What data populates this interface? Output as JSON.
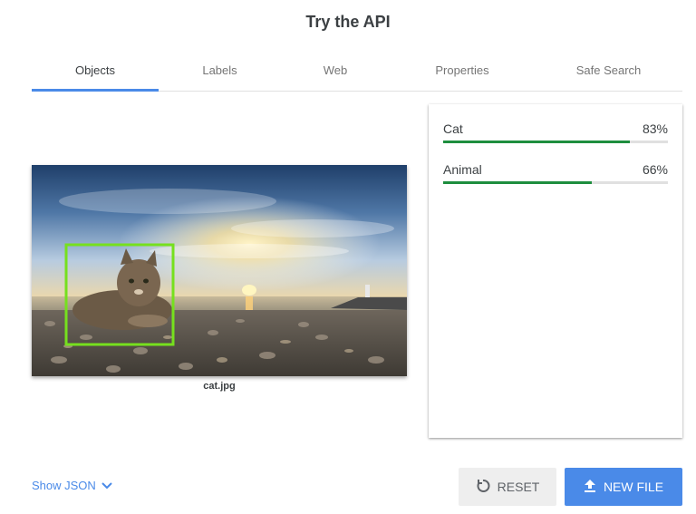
{
  "page": {
    "title": "Try the API"
  },
  "tabs": [
    {
      "label": "Objects",
      "active": true
    },
    {
      "label": "Labels",
      "active": false
    },
    {
      "label": "Web",
      "active": false
    },
    {
      "label": "Properties",
      "active": false
    },
    {
      "label": "Safe Search",
      "active": false
    }
  ],
  "image": {
    "caption": "cat.jpg",
    "detection_box_color": "#76e01e"
  },
  "results": [
    {
      "label": "Cat",
      "score_text": "83%",
      "score": 0.83
    },
    {
      "label": "Animal",
      "score_text": "66%",
      "score": 0.66
    }
  ],
  "footer": {
    "show_json_label": "Show JSON",
    "reset_label": "RESET",
    "new_file_label": "NEW FILE"
  },
  "colors": {
    "accent": "#4a8ae8",
    "bar_fill": "#1e8e3e",
    "bar_track": "#e0e0e0"
  },
  "icons": {
    "show_json": "chevron-down-icon",
    "reset": "reset-icon",
    "new_file": "upload-icon"
  }
}
